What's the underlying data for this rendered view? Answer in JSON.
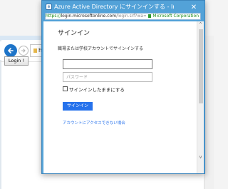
{
  "background_window": {
    "address_text": "http",
    "tab_label": "Login !"
  },
  "popup": {
    "title": "Azure Active Directory にサインインする - Internet Ex...",
    "close_glyph": "✕",
    "url": {
      "scheme": "https://",
      "host": "login.microsoftonline.com",
      "path": "/login.srf?wa=wsig",
      "certificate": "Microsoft Corporation"
    }
  },
  "signin": {
    "title": "サインイン",
    "description": "職場または学校アカウントでサインインする",
    "user_value": "",
    "password_placeholder": "パスワード",
    "keep_signed_in": "サインインしたままにする",
    "button_label": "サインイン",
    "cant_access_link": "アカウントにアクセスできない場合"
  },
  "scrollbar": {
    "up_glyph": "^",
    "down_glyph": "v"
  },
  "colors": {
    "popup_frame": "#53a2d8",
    "accent_blue": "#2672ec",
    "back_button": "#1e74c8",
    "secure_green": "#1a8a1a"
  },
  "icons": {
    "back": "back-arrow-icon",
    "forward": "forward-arrow-icon",
    "lock": "lock-icon",
    "browser": "ie-browser-icon"
  }
}
